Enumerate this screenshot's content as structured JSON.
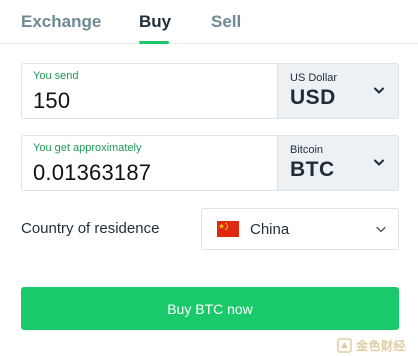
{
  "tabs": {
    "exchange": "Exchange",
    "buy": "Buy",
    "sell": "Sell",
    "active": "Buy"
  },
  "send": {
    "label": "You send",
    "value": "150",
    "currency_name": "US Dollar",
    "currency_code": "USD"
  },
  "get": {
    "label": "You get approximately",
    "value": "0.01363187",
    "currency_name": "Bitcoin",
    "currency_code": "BTC"
  },
  "country": {
    "label": "Country of residence",
    "selected": "China",
    "flag_icon": "china-flag-icon"
  },
  "action": {
    "button_label": "Buy BTC now"
  },
  "watermark": {
    "text": "金色财经"
  },
  "colors": {
    "accent": "#19c96a",
    "label_green": "#1f9a55",
    "muted_tab": "#6e8a93",
    "currency_bg": "#eef1f3"
  }
}
